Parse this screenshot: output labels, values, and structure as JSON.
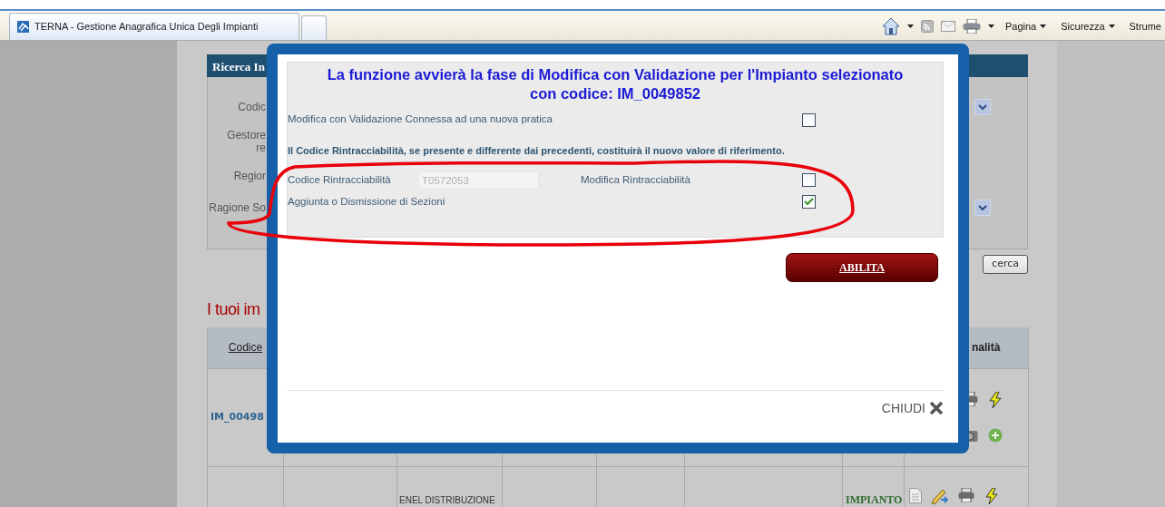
{
  "browser": {
    "tabs": [
      {
        "title": "TERNA - Gestione Anagrafica Unica Degli Impianti",
        "selected": true
      }
    ],
    "menus": [
      "Pagina",
      "Sicurezza",
      "Strume"
    ]
  },
  "search_panel": {
    "title": "Ricerca In",
    "fields": [
      {
        "label_lines": [
          "Codic"
        ],
        "dropdown": true
      },
      {
        "label_lines": [
          "Gestore",
          "re"
        ],
        "dropdown": false
      },
      {
        "label_lines": [
          "Regior"
        ],
        "dropdown": false
      },
      {
        "label_lines": [
          "Ragione So"
        ],
        "dropdown": true
      }
    ],
    "button": "cerca"
  },
  "heading": "I tuoi im",
  "table": {
    "columns": [
      "Codice",
      "nalità"
    ],
    "rows": [
      {
        "code": "IM_00498",
        "actions": [
          {
            "kind": "print"
          },
          {
            "kind": "power"
          },
          {
            "kind": "camera"
          },
          {
            "kind": "add"
          }
        ]
      },
      {
        "column_3": "ENEL DISTRIBUZIONE",
        "status": "IMPIANTO",
        "actions": [
          {
            "kind": "document"
          },
          {
            "kind": "edit"
          },
          {
            "kind": "print"
          },
          {
            "kind": "power"
          }
        ]
      }
    ]
  },
  "dialog": {
    "title": "La funzione avvierà la fase di Modifica con Validazione per l'Impianto selezionato con codice: IM_0049852",
    "rows": [
      {
        "kind": "checkbox",
        "label": "Modifica con Validazione Connessa ad una nuova pratica",
        "checked": false
      },
      {
        "kind": "note",
        "text": "Il Codice Rintracciabilità, se presente e differente dai precedenti, costituirà il nuovo valore di riferimento."
      },
      {
        "kind": "code",
        "label": "Codice Rintracciabilità",
        "value": "T0572053",
        "disabled": true,
        "check_label": "Modifica Rintracciabilità",
        "checked": false
      },
      {
        "kind": "checkbox",
        "label": "Aggiunta o Dismissione di Sezioni",
        "checked": true
      }
    ],
    "confirm_button": "ABILITA",
    "close_label": "CHIUDI"
  },
  "annotations": [
    {
      "kind": "ellipse"
    }
  ]
}
